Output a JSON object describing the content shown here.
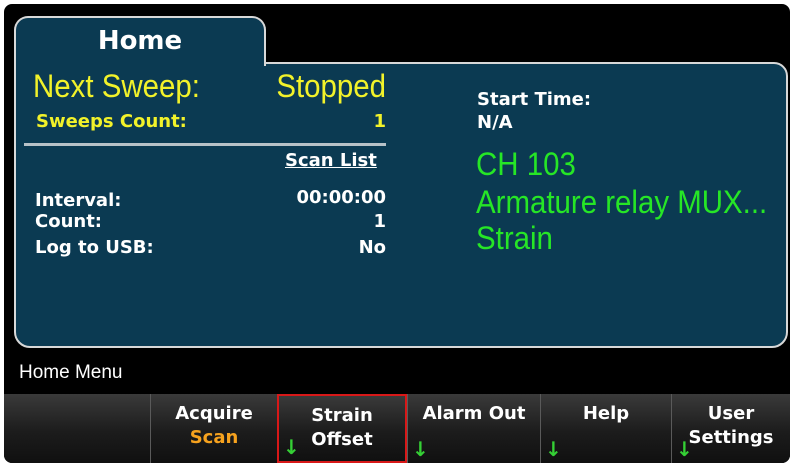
{
  "tab": {
    "label": "Home"
  },
  "sweep": {
    "next_label": "Next Sweep:",
    "next_value": "Stopped",
    "count_label": "Sweeps Count:",
    "count_value": "1"
  },
  "start": {
    "label": "Start Time:",
    "value": "N/A"
  },
  "scan": {
    "list_header": "Scan List",
    "interval_label": "Interval:",
    "interval_value": "00:00:00",
    "count_label": "Count:",
    "count_value": "1",
    "log_label": "Log to USB:",
    "log_value": "No"
  },
  "channel": {
    "line1": "CH 103",
    "line2": "Armature relay MUX...",
    "line3": "Strain"
  },
  "menu": {
    "title": "Home Menu"
  },
  "softkeys": [
    {
      "line1": "",
      "line2": ""
    },
    {
      "line1": "Acquire",
      "line2": "Scan"
    },
    {
      "line1": "Strain",
      "line2": "Offset"
    },
    {
      "line1": "Alarm Out",
      "line2": ""
    },
    {
      "line1": "Help",
      "line2": ""
    },
    {
      "line1": "User",
      "line2": "Settings"
    }
  ],
  "colors": {
    "panel": "#0b3a52",
    "accent_yellow": "#f2f22a",
    "channel_green": "#26e626",
    "softkey_value_orange": "#f6a21e",
    "selected_border": "#d81818"
  },
  "icons": {
    "submenu_arrow": "down-arrow-icon",
    "submenu_arrow_glyph": "↓"
  }
}
